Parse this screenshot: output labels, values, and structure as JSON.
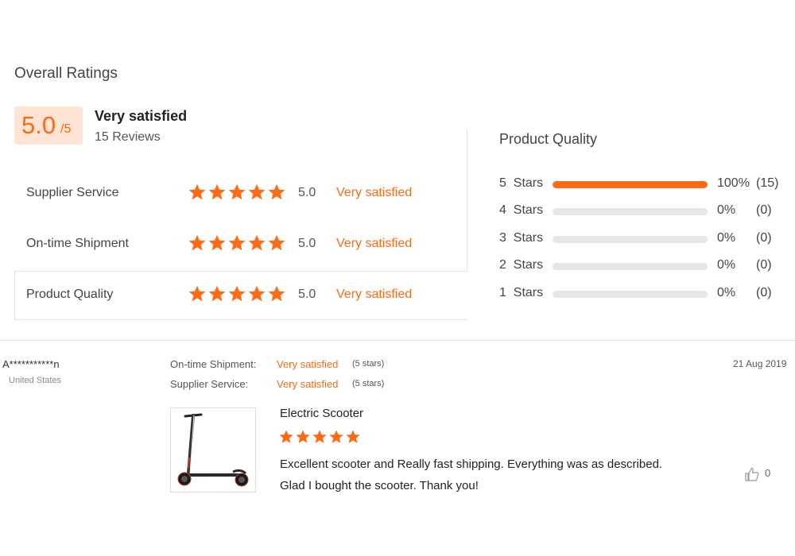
{
  "overall": {
    "title": "Overall Ratings",
    "score": "5.0",
    "score_max": "/5",
    "summary_label": "Very satisfied",
    "reviews_count": "15 Reviews"
  },
  "ratings": [
    {
      "label": "Supplier Service",
      "stars": 5,
      "value": "5.0",
      "satisfaction": "Very satisfied"
    },
    {
      "label": "On-time Shipment",
      "stars": 5,
      "value": "5.0",
      "satisfaction": "Very satisfied"
    },
    {
      "label": "Product Quality",
      "stars": 5,
      "value": "5.0",
      "satisfaction": "Very satisfied"
    }
  ],
  "breakdown": {
    "title": "Product Quality",
    "rows": [
      {
        "label": "5  Stars",
        "fraction": 1.0,
        "percent": "100%",
        "count": "(15)"
      },
      {
        "label": "4  Stars",
        "fraction": 0,
        "percent": "0%",
        "count": "(0)"
      },
      {
        "label": "3  Stars",
        "fraction": 0,
        "percent": "0%",
        "count": "(0)"
      },
      {
        "label": "2  Stars",
        "fraction": 0,
        "percent": "0%",
        "count": "(0)"
      },
      {
        "label": "1  Stars",
        "fraction": 0,
        "percent": "0%",
        "count": "(0)"
      }
    ]
  },
  "review": {
    "reviewer": "A***********n",
    "country": "United States",
    "date": "21 Aug 2019",
    "meta": [
      {
        "key": "On-time Shipment:",
        "value": "Very satisfied",
        "stars_text": "(5 stars)"
      },
      {
        "key": "Supplier Service:",
        "value": "Very satisfied",
        "stars_text": "(5 stars)"
      }
    ],
    "product_name": "Electric Scooter",
    "stars": 5,
    "text_line1": "Excellent scooter and Really fast shipping. Everything was as described.",
    "text_line2": "Glad I bought the scooter. Thank you!",
    "helpful_count": "0",
    "helpful_icon": "thumbs-up-icon"
  },
  "colors": {
    "accent": "#ff6a14",
    "badge_bg": "#fde4d4",
    "track": "#e6e6e6"
  }
}
